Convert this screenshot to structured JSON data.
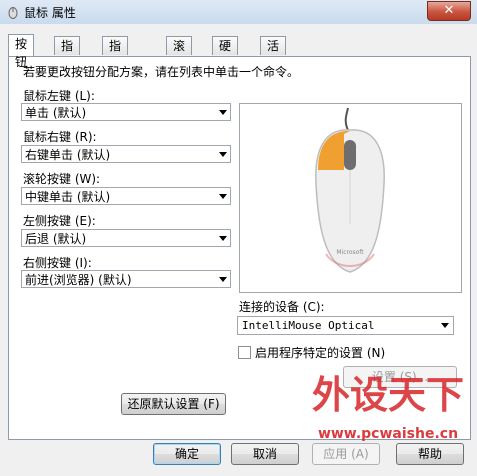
{
  "window": {
    "title": "鼠标 属性",
    "close_label": "✕"
  },
  "tabs": [
    {
      "label": "按钮",
      "active": true
    },
    {
      "label": "指针",
      "active": false
    },
    {
      "label": "指针选项",
      "active": false
    },
    {
      "label": "滚轮",
      "active": false
    },
    {
      "label": "硬件",
      "active": false
    },
    {
      "label": "活动",
      "active": false
    }
  ],
  "buttons_tab": {
    "instruction": "若要更改按钮分配方案，请在列表中单击一个命令。",
    "left_label": "鼠标左键 (L):",
    "left_value": "单击 (默认)",
    "right_label": "鼠标右键 (R):",
    "right_value": "右键单击 (默认)",
    "wheel_label": "滚轮按键 (W):",
    "wheel_value": "中键单击 (默认)",
    "lside_label": "左侧按键 (E):",
    "lside_value": "后退 (默认)",
    "rside_label": "右侧按键 (I):",
    "rside_value": "前进(浏览器) (默认)",
    "device_label": "连接的设备 (C):",
    "device_value": "IntelliMouse Optical",
    "app_specific_label": "启用程序特定的设置 (N)",
    "settings_button": "设置 (S)...",
    "restore_button": "还原默认设置 (F)"
  },
  "footer": {
    "ok": "确定",
    "cancel": "取消",
    "apply": "应用 (A)",
    "help": "帮助"
  },
  "watermark": {
    "brand": "外设天下",
    "url": "www.pcwaishe.cn",
    "photo_text": "Microsoft IntelliMouse"
  },
  "colors": {
    "accent_orange": "#f0a030",
    "watermark_red": "#d8262a"
  }
}
